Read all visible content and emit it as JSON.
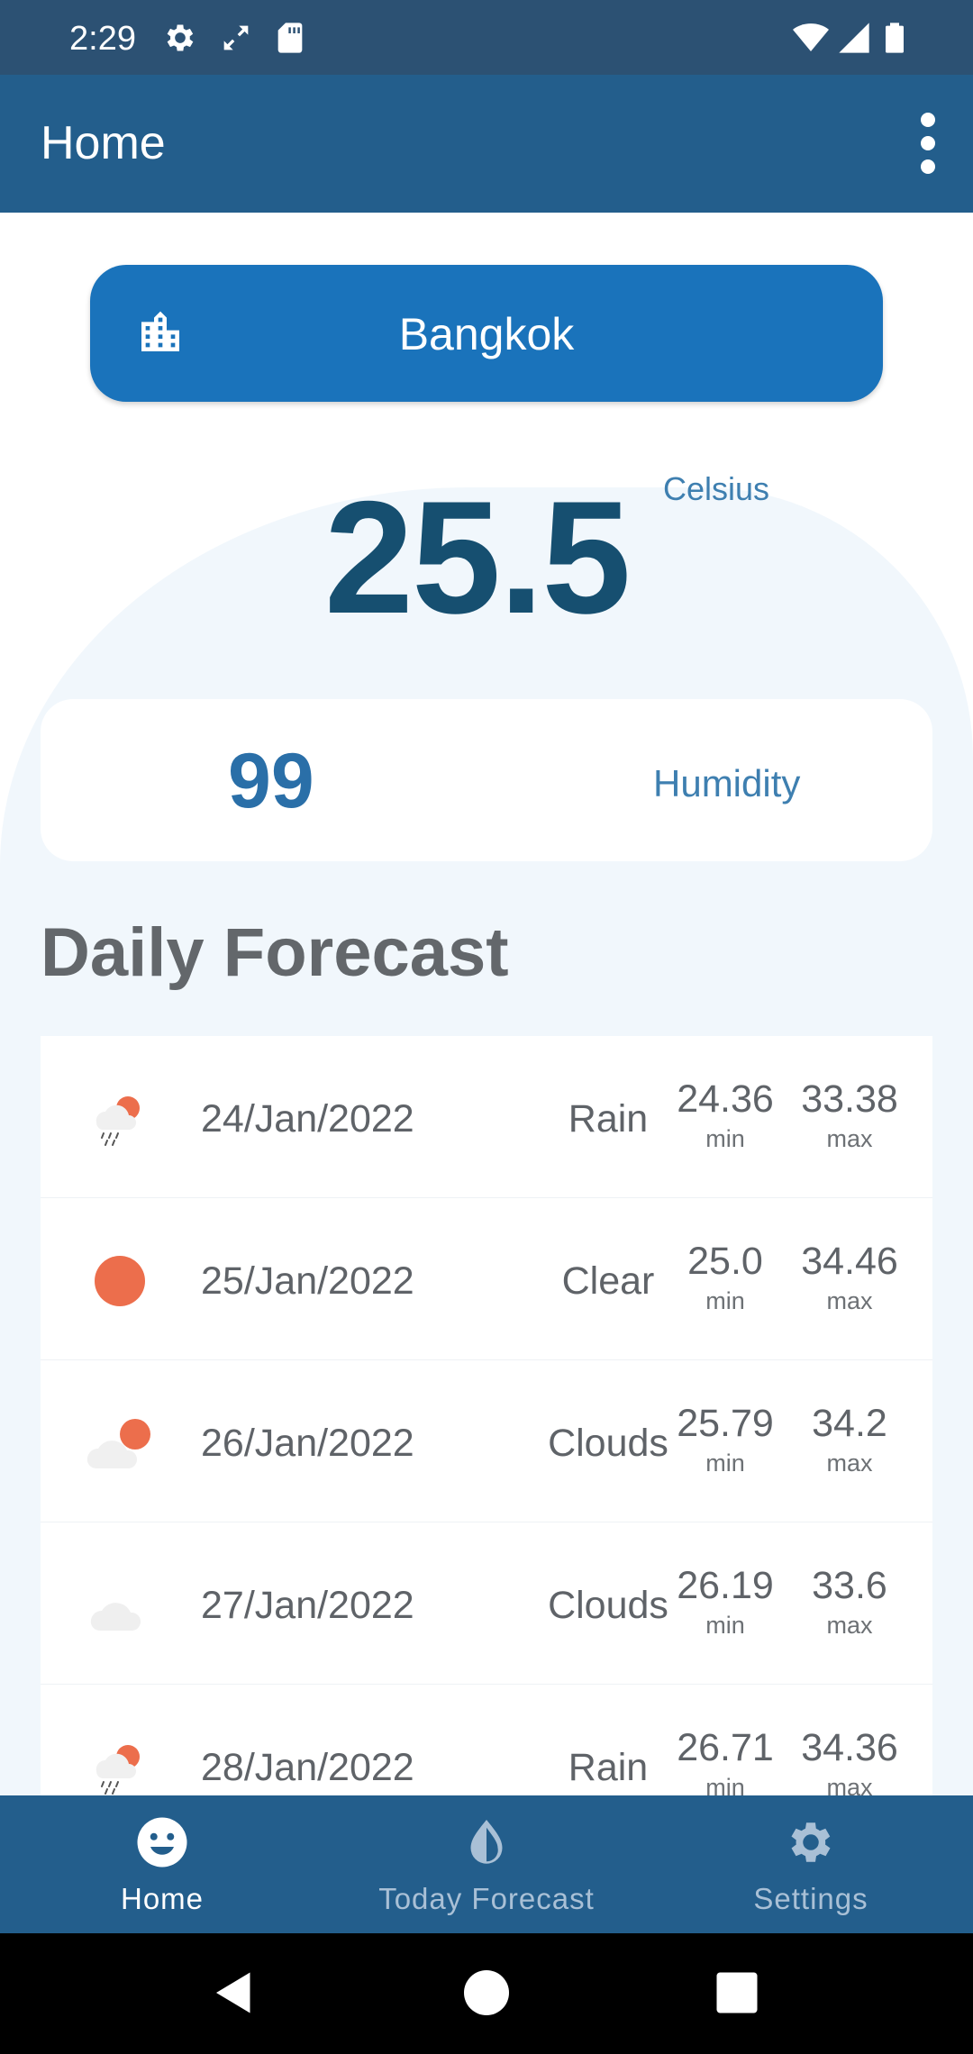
{
  "status_bar": {
    "time": "2:29",
    "icons": [
      "gear-icon",
      "sync-icon",
      "sd-card-icon",
      "wifi-icon",
      "signal-icon",
      "battery-icon"
    ]
  },
  "app_bar": {
    "title": "Home",
    "overflow_icon": "more-vert-icon"
  },
  "city": {
    "icon": "location-city-icon",
    "name": "Bangkok"
  },
  "current": {
    "temperature": "25.5",
    "unit": "Celsius",
    "humidity_value": "99",
    "humidity_label": "Humidity"
  },
  "daily_forecast": {
    "title": "Daily Forecast",
    "min_caption": "min",
    "max_caption": "max",
    "items": [
      {
        "icon": "rain-icon",
        "date": "24/Jan/2022",
        "description": "Rain",
        "min": "24.36",
        "max": "33.38"
      },
      {
        "icon": "clear-sun-icon",
        "date": "25/Jan/2022",
        "description": "Clear",
        "min": "25.0",
        "max": "34.46"
      },
      {
        "icon": "cloud-sun-icon",
        "date": "26/Jan/2022",
        "description": "Clouds",
        "min": "25.79",
        "max": "34.2"
      },
      {
        "icon": "cloud-icon",
        "date": "27/Jan/2022",
        "description": "Clouds",
        "min": "26.19",
        "max": "33.6"
      },
      {
        "icon": "rain-icon",
        "date": "28/Jan/2022",
        "description": "Rain",
        "min": "26.71",
        "max": "34.36"
      }
    ]
  },
  "bottom_nav": {
    "items": [
      {
        "label": "Home",
        "icon": "smiley-icon",
        "active": true
      },
      {
        "label": "Today Forecast",
        "icon": "water-drop-icon",
        "active": false
      },
      {
        "label": "Settings",
        "icon": "gear-icon",
        "active": false
      }
    ]
  },
  "colors": {
    "status_bar": "#2c5173",
    "app_bar": "#235e8c",
    "accent": "#1a73bb",
    "temperature": "#164f70",
    "sun": "#ec6e4c"
  }
}
